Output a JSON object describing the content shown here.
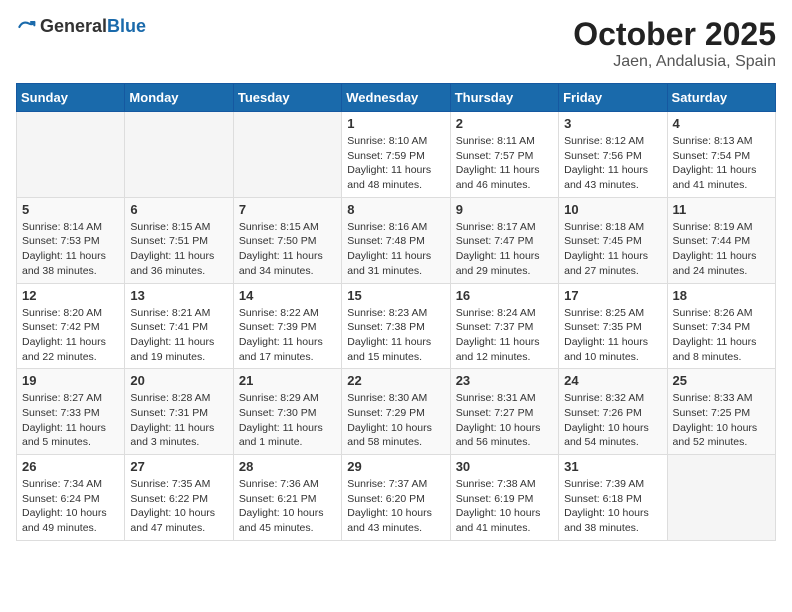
{
  "logo": {
    "text_general": "General",
    "text_blue": "Blue"
  },
  "header": {
    "month": "October 2025",
    "location": "Jaen, Andalusia, Spain"
  },
  "weekdays": [
    "Sunday",
    "Monday",
    "Tuesday",
    "Wednesday",
    "Thursday",
    "Friday",
    "Saturday"
  ],
  "weeks": [
    [
      {
        "day": "",
        "info": ""
      },
      {
        "day": "",
        "info": ""
      },
      {
        "day": "",
        "info": ""
      },
      {
        "day": "1",
        "info": "Sunrise: 8:10 AM\nSunset: 7:59 PM\nDaylight: 11 hours and 48 minutes."
      },
      {
        "day": "2",
        "info": "Sunrise: 8:11 AM\nSunset: 7:57 PM\nDaylight: 11 hours and 46 minutes."
      },
      {
        "day": "3",
        "info": "Sunrise: 8:12 AM\nSunset: 7:56 PM\nDaylight: 11 hours and 43 minutes."
      },
      {
        "day": "4",
        "info": "Sunrise: 8:13 AM\nSunset: 7:54 PM\nDaylight: 11 hours and 41 minutes."
      }
    ],
    [
      {
        "day": "5",
        "info": "Sunrise: 8:14 AM\nSunset: 7:53 PM\nDaylight: 11 hours and 38 minutes."
      },
      {
        "day": "6",
        "info": "Sunrise: 8:15 AM\nSunset: 7:51 PM\nDaylight: 11 hours and 36 minutes."
      },
      {
        "day": "7",
        "info": "Sunrise: 8:15 AM\nSunset: 7:50 PM\nDaylight: 11 hours and 34 minutes."
      },
      {
        "day": "8",
        "info": "Sunrise: 8:16 AM\nSunset: 7:48 PM\nDaylight: 11 hours and 31 minutes."
      },
      {
        "day": "9",
        "info": "Sunrise: 8:17 AM\nSunset: 7:47 PM\nDaylight: 11 hours and 29 minutes."
      },
      {
        "day": "10",
        "info": "Sunrise: 8:18 AM\nSunset: 7:45 PM\nDaylight: 11 hours and 27 minutes."
      },
      {
        "day": "11",
        "info": "Sunrise: 8:19 AM\nSunset: 7:44 PM\nDaylight: 11 hours and 24 minutes."
      }
    ],
    [
      {
        "day": "12",
        "info": "Sunrise: 8:20 AM\nSunset: 7:42 PM\nDaylight: 11 hours and 22 minutes."
      },
      {
        "day": "13",
        "info": "Sunrise: 8:21 AM\nSunset: 7:41 PM\nDaylight: 11 hours and 19 minutes."
      },
      {
        "day": "14",
        "info": "Sunrise: 8:22 AM\nSunset: 7:39 PM\nDaylight: 11 hours and 17 minutes."
      },
      {
        "day": "15",
        "info": "Sunrise: 8:23 AM\nSunset: 7:38 PM\nDaylight: 11 hours and 15 minutes."
      },
      {
        "day": "16",
        "info": "Sunrise: 8:24 AM\nSunset: 7:37 PM\nDaylight: 11 hours and 12 minutes."
      },
      {
        "day": "17",
        "info": "Sunrise: 8:25 AM\nSunset: 7:35 PM\nDaylight: 11 hours and 10 minutes."
      },
      {
        "day": "18",
        "info": "Sunrise: 8:26 AM\nSunset: 7:34 PM\nDaylight: 11 hours and 8 minutes."
      }
    ],
    [
      {
        "day": "19",
        "info": "Sunrise: 8:27 AM\nSunset: 7:33 PM\nDaylight: 11 hours and 5 minutes."
      },
      {
        "day": "20",
        "info": "Sunrise: 8:28 AM\nSunset: 7:31 PM\nDaylight: 11 hours and 3 minutes."
      },
      {
        "day": "21",
        "info": "Sunrise: 8:29 AM\nSunset: 7:30 PM\nDaylight: 11 hours and 1 minute."
      },
      {
        "day": "22",
        "info": "Sunrise: 8:30 AM\nSunset: 7:29 PM\nDaylight: 10 hours and 58 minutes."
      },
      {
        "day": "23",
        "info": "Sunrise: 8:31 AM\nSunset: 7:27 PM\nDaylight: 10 hours and 56 minutes."
      },
      {
        "day": "24",
        "info": "Sunrise: 8:32 AM\nSunset: 7:26 PM\nDaylight: 10 hours and 54 minutes."
      },
      {
        "day": "25",
        "info": "Sunrise: 8:33 AM\nSunset: 7:25 PM\nDaylight: 10 hours and 52 minutes."
      }
    ],
    [
      {
        "day": "26",
        "info": "Sunrise: 7:34 AM\nSunset: 6:24 PM\nDaylight: 10 hours and 49 minutes."
      },
      {
        "day": "27",
        "info": "Sunrise: 7:35 AM\nSunset: 6:22 PM\nDaylight: 10 hours and 47 minutes."
      },
      {
        "day": "28",
        "info": "Sunrise: 7:36 AM\nSunset: 6:21 PM\nDaylight: 10 hours and 45 minutes."
      },
      {
        "day": "29",
        "info": "Sunrise: 7:37 AM\nSunset: 6:20 PM\nDaylight: 10 hours and 43 minutes."
      },
      {
        "day": "30",
        "info": "Sunrise: 7:38 AM\nSunset: 6:19 PM\nDaylight: 10 hours and 41 minutes."
      },
      {
        "day": "31",
        "info": "Sunrise: 7:39 AM\nSunset: 6:18 PM\nDaylight: 10 hours and 38 minutes."
      },
      {
        "day": "",
        "info": ""
      }
    ]
  ]
}
